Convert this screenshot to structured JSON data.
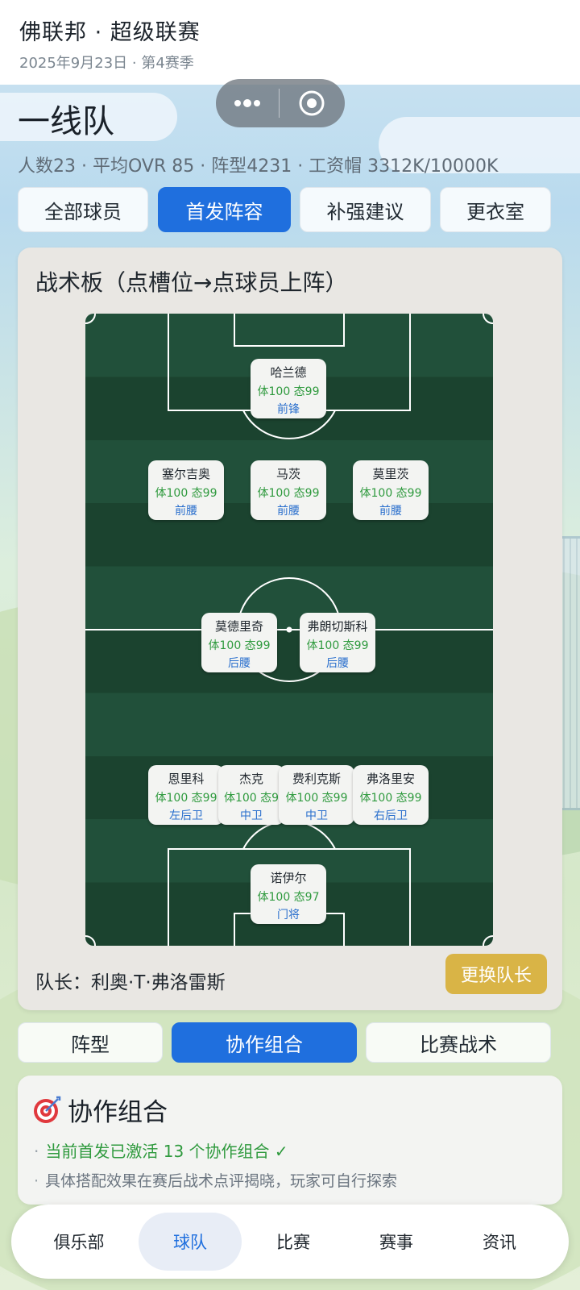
{
  "header": {
    "title": "佛联邦 · 超级联赛",
    "subtitle": "2025年9月23日 · 第4赛季"
  },
  "page": {
    "title": "一线队",
    "stats": "人数23 · 平均OVR 85 · 阵型4231 · 工资帽 3312K/10000K"
  },
  "top_tabs": [
    "全部球员",
    "首发阵容",
    "补强建议",
    "更衣室"
  ],
  "top_tab_active": "首发阵容",
  "board": {
    "title": "战术板（点槽位→点球员上阵）",
    "captain_label": "队长：利奥·T·弗洛雷斯",
    "change_captain_button": "更换队长"
  },
  "players": [
    {
      "name": "哈兰德",
      "stats": "体100 态99",
      "position": "前锋"
    },
    {
      "name": "塞尔吉奥",
      "stats": "体100 态99",
      "position": "前腰"
    },
    {
      "name": "马茨",
      "stats": "体100 态99",
      "position": "前腰"
    },
    {
      "name": "莫里茨",
      "stats": "体100 态99",
      "position": "前腰"
    },
    {
      "name": "莫德里奇",
      "stats": "体100 态99",
      "position": "后腰"
    },
    {
      "name": "弗朗切斯科",
      "stats": "体100 态99",
      "position": "后腰"
    },
    {
      "name": "恩里科",
      "stats": "体100 态99",
      "position": "左后卫"
    },
    {
      "name": "杰克",
      "stats": "体100 态9",
      "position": "中卫"
    },
    {
      "name": "费利克斯",
      "stats": "体100 态99",
      "position": "中卫"
    },
    {
      "name": "弗洛里安",
      "stats": "体100 态99",
      "position": "右后卫"
    },
    {
      "name": "诺伊尔",
      "stats": "体100 态97",
      "position": "门将"
    }
  ],
  "sub_tabs": [
    "阵型",
    "协作组合",
    "比赛战术"
  ],
  "sub_tab_active": "协作组合",
  "combo": {
    "icon": "target-icon",
    "title": "协作组合",
    "line1": "当前首发已激活 13 个协作组合 ✓",
    "line2": "具体搭配效果在赛后战术点评揭晓，玩家可自行探索"
  },
  "bottom_tabs": [
    "俱乐部",
    "球队",
    "比赛",
    "赛事",
    "资讯"
  ],
  "bottom_tab_active": "球队",
  "colors": {
    "accent": "#1f6fde",
    "pitch_dark": "#1b432f",
    "pitch_light": "#21503a",
    "gold_button": "#d9b446",
    "stat_green": "#2f9a3e"
  }
}
